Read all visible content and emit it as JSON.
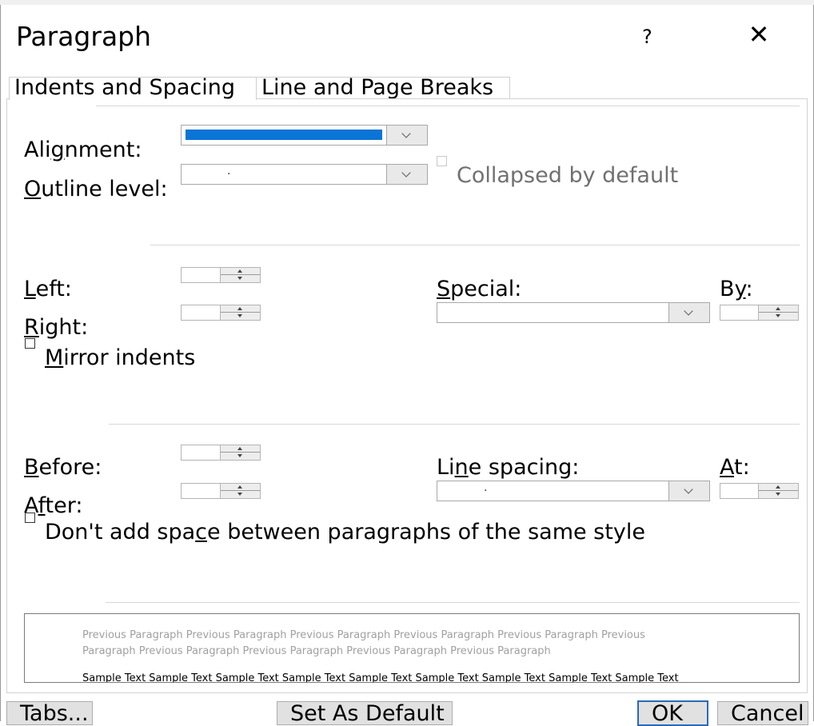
{
  "dialog": {
    "title": "Paragraph",
    "help_glyph": "?",
    "close_glyph": "✕"
  },
  "tabs": [
    {
      "label": "Indents and Spacing"
    },
    {
      "label": "Line and Page Breaks"
    }
  ],
  "general": {
    "alignment": {
      "label_a": "Ali",
      "label_u": "g",
      "label_b": "nment:",
      "selected_color": "#0a75d6"
    },
    "outline": {
      "label_u": "O",
      "label_b": "utline level:",
      "value": "."
    },
    "collapsed": {
      "label": "Collapsed by default",
      "checked": false,
      "disabled": true
    }
  },
  "indentation": {
    "left": {
      "label_u": "L",
      "label_b": "eft:"
    },
    "right": {
      "label_u": "R",
      "label_b": "ight:"
    },
    "special": {
      "label_u": "S",
      "label_b": "pecial:"
    },
    "by": {
      "label_a": "B",
      "label_u": "y",
      "label_b": ":"
    },
    "mirror": {
      "label_u": "M",
      "label_b": "irror indents",
      "checked": false
    }
  },
  "spacing": {
    "before": {
      "label_u": "B",
      "label_b": "efore:"
    },
    "after": {
      "label_u": "f",
      "label_a": "A",
      "label_b": "ter:"
    },
    "line_spacing": {
      "label_a": "Li",
      "label_u": "n",
      "label_b": "e spacing:",
      "value": "."
    },
    "at": {
      "label_u": "A",
      "label_b": "t:"
    },
    "dont_add": {
      "label_a": "Don't add spa",
      "label_u": "c",
      "label_b": "e between paragraphs of the same style",
      "checked": false
    }
  },
  "preview": {
    "previous_line_1": "Previous Paragraph Previous Paragraph Previous Paragraph Previous Paragraph Previous Paragraph Previous",
    "previous_line_2": "Paragraph Previous Paragraph Previous Paragraph Previous Paragraph Previous Paragraph",
    "sample_line": "Sample Text Sample Text Sample Text Sample Text Sample Text Sample Text Sample Text Sample Text Sample Text"
  },
  "buttons": {
    "tabs": "Tabs...",
    "set_as_default": "Set As Default",
    "ok": "OK",
    "cancel": "Cancel"
  },
  "colors": {
    "accent": "#0a75d6",
    "ok_border": "#2a6ab8"
  }
}
